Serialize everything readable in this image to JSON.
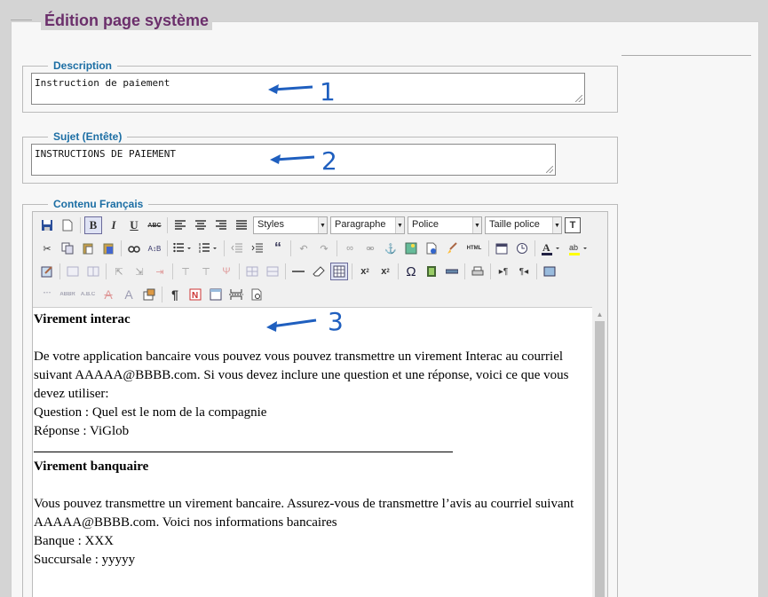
{
  "page": {
    "title": "Édition page système"
  },
  "description": {
    "legend": "Description",
    "value": "Instruction de paiement"
  },
  "subject": {
    "legend": "Sujet (Entête)",
    "value": "INSTRUCTIONS DE PAIEMENT"
  },
  "content_fr": {
    "legend": "Contenu Français"
  },
  "annotations": [
    "1",
    "2",
    "3"
  ],
  "toolbar": {
    "styles_select": "Styles",
    "paragraph_select": "Paragraphe",
    "font_select": "Police",
    "size_select": "Taille police",
    "bold_label": "B",
    "italic_label": "I",
    "underline_label": "U",
    "strike_label": "ABC",
    "html_label": "HTML",
    "plain_label": "T"
  },
  "editor_content": {
    "heading1": "Virement interac",
    "para1": "De votre application bancaire vous pouvez vous pouvez transmettre un virement Interac au courriel suivant AAAAA@BBBB.com. Si vous devez inclure une question et une réponse, voici ce que vous devez utiliser:",
    "question": "Question : Quel est le nom de la compagnie",
    "answer": "Réponse : ViGlob",
    "heading2": "Virement banquaire",
    "para2": "Vous pouvez transmettre un virement bancaire. Assurez-vous de transmettre l’avis au courriel suivant AAAAA@BBBB.com. Voici nos informations bancaires",
    "bank": "Banque : XXX",
    "branch": "Succursale : yyyyy"
  },
  "colors": {
    "title": "#6b2f6b",
    "legend": "#1c6ea4",
    "annotation": "#1f5fbf"
  }
}
